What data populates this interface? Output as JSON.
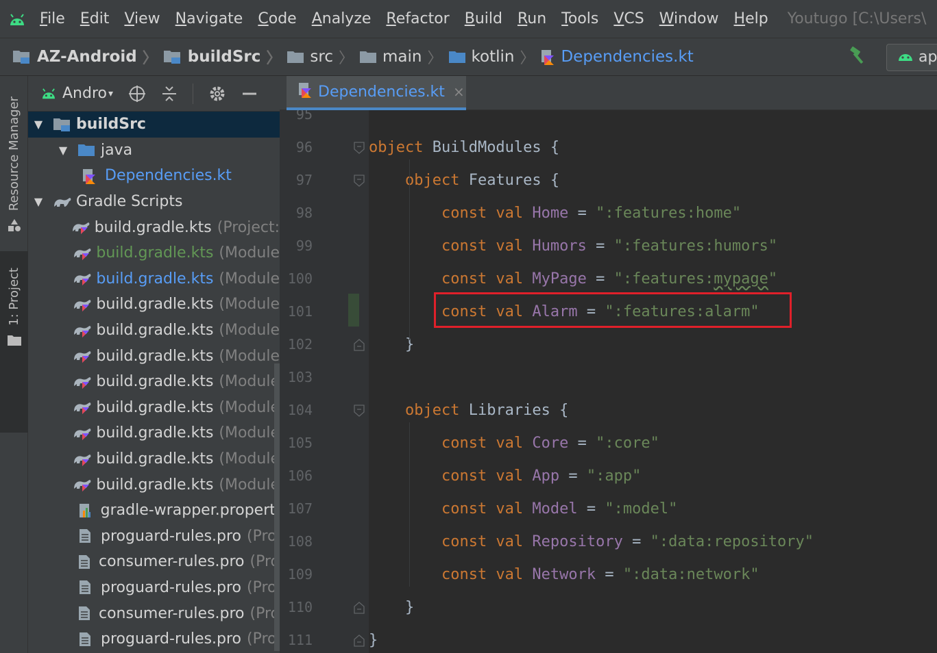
{
  "menu": {
    "items": [
      "File",
      "Edit",
      "View",
      "Navigate",
      "Code",
      "Analyze",
      "Refactor",
      "Build",
      "Run",
      "Tools",
      "VCS",
      "Window",
      "Help"
    ],
    "window_title": "Youtugo [C:\\Users\\"
  },
  "breadcrumb": {
    "items": [
      {
        "label": "AZ-Android",
        "icon": "module-folder-icon"
      },
      {
        "label": "buildSrc",
        "icon": "module-folder-icon"
      },
      {
        "label": "src",
        "icon": "folder-icon"
      },
      {
        "label": "main",
        "icon": "folder-icon"
      },
      {
        "label": "kotlin",
        "icon": "source-folder-icon"
      },
      {
        "label": "Dependencies.kt",
        "icon": "kotlin-file-icon"
      }
    ],
    "run_config_label": "ap"
  },
  "tool_windows": {
    "resource_manager": "Resource Manager",
    "project": "1: Project"
  },
  "project_panel": {
    "view_mode": "Andro",
    "tree": [
      {
        "label": "buildSrc",
        "suffix": "",
        "level": 0,
        "expanded": true,
        "icon": "module-folder-icon",
        "style": "bold"
      },
      {
        "label": "java",
        "suffix": "",
        "level": 1,
        "expanded": true,
        "icon": "source-folder-icon",
        "style": "normal"
      },
      {
        "label": "Dependencies.kt",
        "suffix": "",
        "level": 2,
        "expanded": null,
        "icon": "kotlin-file-icon",
        "style": "blue"
      },
      {
        "label": "Gradle Scripts",
        "suffix": "",
        "level": 0,
        "expanded": true,
        "icon": "gradle-icon",
        "style": "normal"
      },
      {
        "label": "build.gradle.kts",
        "suffix": "(Project:",
        "level": 1,
        "expanded": null,
        "icon": "gradle-kts-icon",
        "style": "normal"
      },
      {
        "label": "build.gradle.kts",
        "suffix": "(Module",
        "level": 1,
        "expanded": null,
        "icon": "gradle-kts-icon",
        "style": "green"
      },
      {
        "label": "build.gradle.kts",
        "suffix": "(Module",
        "level": 1,
        "expanded": null,
        "icon": "gradle-kts-icon",
        "style": "blue"
      },
      {
        "label": "build.gradle.kts",
        "suffix": "(Module",
        "level": 1,
        "expanded": null,
        "icon": "gradle-kts-icon",
        "style": "normal"
      },
      {
        "label": "build.gradle.kts",
        "suffix": "(Module",
        "level": 1,
        "expanded": null,
        "icon": "gradle-kts-icon",
        "style": "normal"
      },
      {
        "label": "build.gradle.kts",
        "suffix": "(Module",
        "level": 1,
        "expanded": null,
        "icon": "gradle-kts-icon",
        "style": "normal"
      },
      {
        "label": "build.gradle.kts",
        "suffix": "(Module",
        "level": 1,
        "expanded": null,
        "icon": "gradle-kts-icon",
        "style": "normal"
      },
      {
        "label": "build.gradle.kts",
        "suffix": "(Module",
        "level": 1,
        "expanded": null,
        "icon": "gradle-kts-icon",
        "style": "normal"
      },
      {
        "label": "build.gradle.kts",
        "suffix": "(Module",
        "level": 1,
        "expanded": null,
        "icon": "gradle-kts-icon",
        "style": "normal"
      },
      {
        "label": "build.gradle.kts",
        "suffix": "(Module",
        "level": 1,
        "expanded": null,
        "icon": "gradle-kts-icon",
        "style": "normal"
      },
      {
        "label": "build.gradle.kts",
        "suffix": "(Module",
        "level": 1,
        "expanded": null,
        "icon": "gradle-kts-icon",
        "style": "normal"
      },
      {
        "label": "gradle-wrapper.properti",
        "suffix": "",
        "level": 1,
        "expanded": null,
        "icon": "properties-file-icon",
        "style": "normal"
      },
      {
        "label": "proguard-rules.pro",
        "suffix": "(Pro",
        "level": 1,
        "expanded": null,
        "icon": "text-file-icon",
        "style": "normal"
      },
      {
        "label": "consumer-rules.pro",
        "suffix": "(Pro",
        "level": 1,
        "expanded": null,
        "icon": "text-file-icon",
        "style": "normal"
      },
      {
        "label": "proguard-rules.pro",
        "suffix": "(Pro",
        "level": 1,
        "expanded": null,
        "icon": "text-file-icon",
        "style": "normal"
      },
      {
        "label": "consumer-rules.pro",
        "suffix": "(Pro",
        "level": 1,
        "expanded": null,
        "icon": "text-file-icon",
        "style": "normal"
      },
      {
        "label": "proguard-rules.pro",
        "suffix": "(Pro",
        "level": 1,
        "expanded": null,
        "icon": "text-file-icon",
        "style": "normal"
      }
    ]
  },
  "editor": {
    "tab_label": "Dependencies.kt",
    "tab_close": "×",
    "lines": [
      {
        "num": "95",
        "tokens": []
      },
      {
        "num": "96",
        "fold": "open",
        "tokens": [
          {
            "t": "object ",
            "c": "kw"
          },
          {
            "t": "BuildModules {",
            "c": "ty"
          }
        ]
      },
      {
        "num": "97",
        "fold": "open",
        "tokens": [
          {
            "t": "    object ",
            "c": "kw"
          },
          {
            "t": "Features {",
            "c": "ty"
          }
        ]
      },
      {
        "num": "98",
        "tokens": [
          {
            "t": "        const val ",
            "c": "kw"
          },
          {
            "t": "Home",
            "c": "pn"
          },
          {
            "t": " = ",
            "c": "op"
          },
          {
            "t": "\":features:home\"",
            "c": "st"
          }
        ]
      },
      {
        "num": "99",
        "tokens": [
          {
            "t": "        const val ",
            "c": "kw"
          },
          {
            "t": "Humors",
            "c": "pn"
          },
          {
            "t": " = ",
            "c": "op"
          },
          {
            "t": "\":features:humors\"",
            "c": "st"
          }
        ]
      },
      {
        "num": "100",
        "tokens": [
          {
            "t": "        const val ",
            "c": "kw"
          },
          {
            "t": "MyPage",
            "c": "pn"
          },
          {
            "t": " = ",
            "c": "op"
          },
          {
            "t": "\":features:",
            "c": "st"
          },
          {
            "t": "mypage",
            "c": "st squiggle"
          },
          {
            "t": "\"",
            "c": "st"
          }
        ]
      },
      {
        "num": "101",
        "tokens": [
          {
            "t": "        const val ",
            "c": "kw"
          },
          {
            "t": "Alarm",
            "c": "pn"
          },
          {
            "t": " = ",
            "c": "op"
          },
          {
            "t": "\":features:alarm\"",
            "c": "st"
          }
        ]
      },
      {
        "num": "102",
        "fold": "close",
        "tokens": [
          {
            "t": "    }",
            "c": "ty"
          }
        ]
      },
      {
        "num": "103",
        "tokens": []
      },
      {
        "num": "104",
        "fold": "open",
        "tokens": [
          {
            "t": "    object ",
            "c": "kw"
          },
          {
            "t": "Libraries {",
            "c": "ty"
          }
        ]
      },
      {
        "num": "105",
        "tokens": [
          {
            "t": "        const val ",
            "c": "kw"
          },
          {
            "t": "Core",
            "c": "pn"
          },
          {
            "t": " = ",
            "c": "op"
          },
          {
            "t": "\":core\"",
            "c": "st"
          }
        ]
      },
      {
        "num": "106",
        "tokens": [
          {
            "t": "        const val ",
            "c": "kw"
          },
          {
            "t": "App",
            "c": "pn"
          },
          {
            "t": " = ",
            "c": "op"
          },
          {
            "t": "\":app\"",
            "c": "st"
          }
        ]
      },
      {
        "num": "107",
        "tokens": [
          {
            "t": "        const val ",
            "c": "kw"
          },
          {
            "t": "Model",
            "c": "pn"
          },
          {
            "t": " = ",
            "c": "op"
          },
          {
            "t": "\":model\"",
            "c": "st"
          }
        ]
      },
      {
        "num": "108",
        "tokens": [
          {
            "t": "        const val ",
            "c": "kw"
          },
          {
            "t": "Repository",
            "c": "pn"
          },
          {
            "t": " = ",
            "c": "op"
          },
          {
            "t": "\":data:repository\"",
            "c": "st"
          }
        ]
      },
      {
        "num": "109",
        "tokens": [
          {
            "t": "        const val ",
            "c": "kw"
          },
          {
            "t": "Network",
            "c": "pn"
          },
          {
            "t": " = ",
            "c": "op"
          },
          {
            "t": "\":data:network\"",
            "c": "st"
          }
        ]
      },
      {
        "num": "110",
        "fold": "close",
        "tokens": [
          {
            "t": "    }",
            "c": "ty"
          }
        ]
      },
      {
        "num": "111",
        "fold": "close",
        "tokens": [
          {
            "t": "}",
            "c": "ty"
          }
        ]
      }
    ],
    "highlighted_line": "101"
  },
  "colors": {
    "keyword": "#cc7832",
    "property": "#9876aa",
    "string": "#6a8759",
    "highlight_box": "#e0202a",
    "link_blue": "#589df6",
    "android_green": "#3ddc84"
  }
}
